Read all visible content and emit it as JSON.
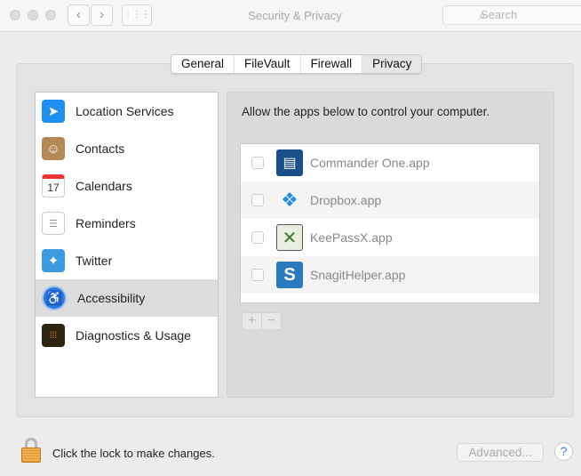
{
  "window": {
    "title": "Security & Privacy",
    "search_placeholder": "Search",
    "back": "‹",
    "forward": "›",
    "grid": "⋮⋮⋮"
  },
  "tabs": [
    {
      "label": "General"
    },
    {
      "label": "FileVault"
    },
    {
      "label": "Firewall"
    },
    {
      "label": "Privacy",
      "selected": true
    }
  ],
  "sidebar": {
    "items": [
      {
        "label": "Location Services",
        "icon": "location-arrow-icon",
        "color": "#1e8ff0"
      },
      {
        "label": "Contacts",
        "icon": "contacts-book-icon",
        "color": "#b38a55"
      },
      {
        "label": "Calendars",
        "icon": "calendar-icon",
        "color": "#ffffff"
      },
      {
        "label": "Reminders",
        "icon": "reminders-list-icon",
        "color": "#ffffff"
      },
      {
        "label": "Twitter",
        "icon": "twitter-bird-icon",
        "color": "#3a9be0"
      },
      {
        "label": "Accessibility",
        "icon": "accessibility-icon",
        "color": "#2a7ad8",
        "selected": true
      },
      {
        "label": "Diagnostics & Usage",
        "icon": "diagnostics-grid-icon",
        "color": "#2b2210"
      }
    ]
  },
  "calendar_day": "17",
  "main": {
    "prompt": "Allow the apps below to control your computer.",
    "apps": [
      {
        "name": "Commander One.app",
        "checked": false,
        "icon": "commander-one-icon",
        "color": "#1a4f8a"
      },
      {
        "name": "Dropbox.app",
        "checked": false,
        "icon": "dropbox-icon",
        "color": "#2a8fe0"
      },
      {
        "name": "KeePassX.app",
        "checked": false,
        "icon": "keepassx-icon",
        "color": "#3a7a2a"
      },
      {
        "name": "SnagitHelper.app",
        "checked": false,
        "icon": "snagit-icon",
        "color": "#2a7ac0"
      }
    ],
    "add": "+",
    "remove": "−"
  },
  "footer": {
    "lock_text": "Click the lock to make changes.",
    "advanced": "Advanced...",
    "help": "?"
  }
}
